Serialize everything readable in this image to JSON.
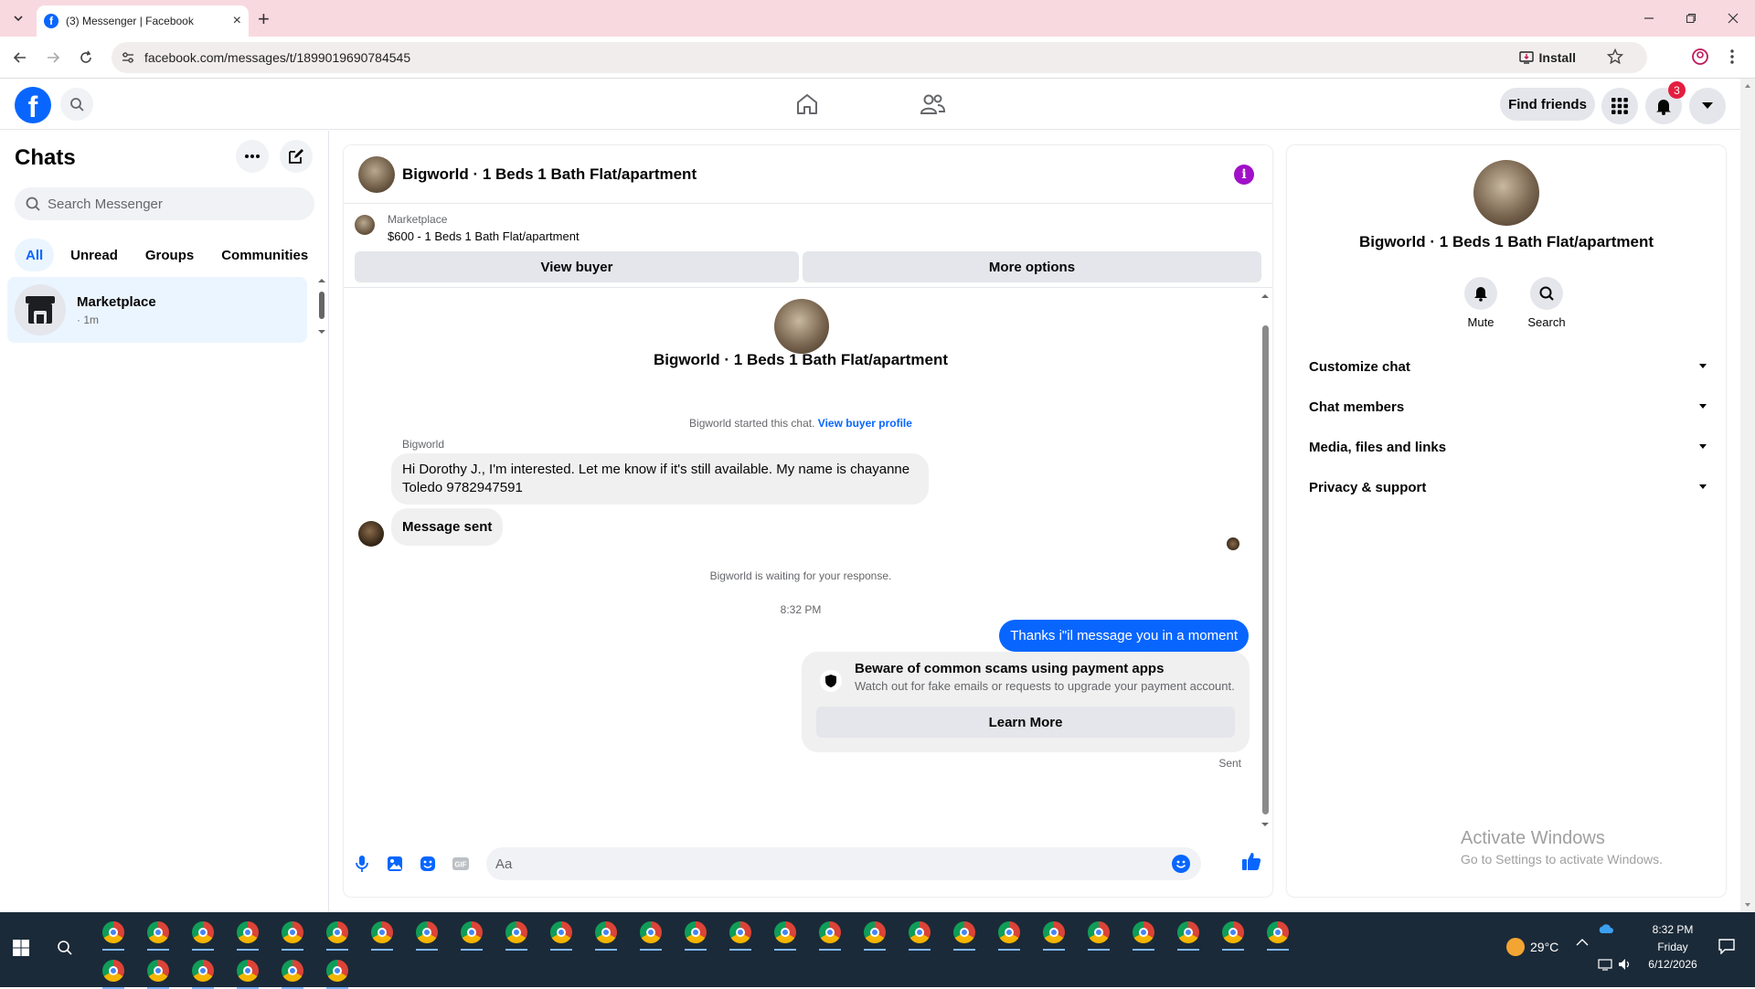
{
  "browser": {
    "tab_title": "(3) Messenger | Facebook",
    "url": "facebook.com/messages/t/1899019690784545",
    "install_label": "Install",
    "accent": "#f9d9e0"
  },
  "fb_header": {
    "find_friends_label": "Find friends",
    "notification_count": "3",
    "brand_color": "#0866ff"
  },
  "sidebar": {
    "title": "Chats",
    "search_placeholder": "Search Messenger",
    "filters": [
      "All",
      "Unread",
      "Groups",
      "Communities"
    ],
    "active_filter": "All",
    "chat_item": {
      "name": "Marketplace",
      "time": "· 1m"
    }
  },
  "conversation": {
    "title": "Bigworld · 1 Beds 1 Bath Flat/apartment",
    "marketplace_label": "Marketplace",
    "listing": "$600 - 1 Beds 1 Bath Flat/apartment",
    "view_buyer_label": "View buyer",
    "more_options_label": "More options",
    "intro_title": "Bigworld · 1 Beds 1 Bath Flat/apartment",
    "started_text": "Bigworld started this chat.",
    "view_buyer_profile": "View buyer profile",
    "sender": "Bigworld",
    "message_1": "Hi Dorothy J., I'm interested. Let me know if it's still available. My name is chayanne Toledo 9782947591",
    "message_2": "Message sent",
    "waiting_text": "Bigworld is waiting for your response.",
    "timestamp": "8:32 PM",
    "my_message": "Thanks i\"il message you in a moment",
    "scam_title": "Beware of common scams using payment apps",
    "scam_text": "Watch out for fake emails or requests to upgrade your payment account.",
    "learn_more_label": "Learn More",
    "sent_label": "Sent",
    "composer_placeholder": "Aa"
  },
  "details": {
    "title": "Bigworld · 1 Beds 1 Bath Flat/apartment",
    "mute_label": "Mute",
    "search_label": "Search",
    "sections": [
      "Customize chat",
      "Chat members",
      "Media, files and links",
      "Privacy & support"
    ]
  },
  "watermark": {
    "line1": "Activate Windows",
    "line2": "Go to Settings to activate Windows."
  },
  "taskbar": {
    "weather": "29°C",
    "time": "8:32 PM",
    "day": "Friday",
    "date": "6/12/2026"
  }
}
